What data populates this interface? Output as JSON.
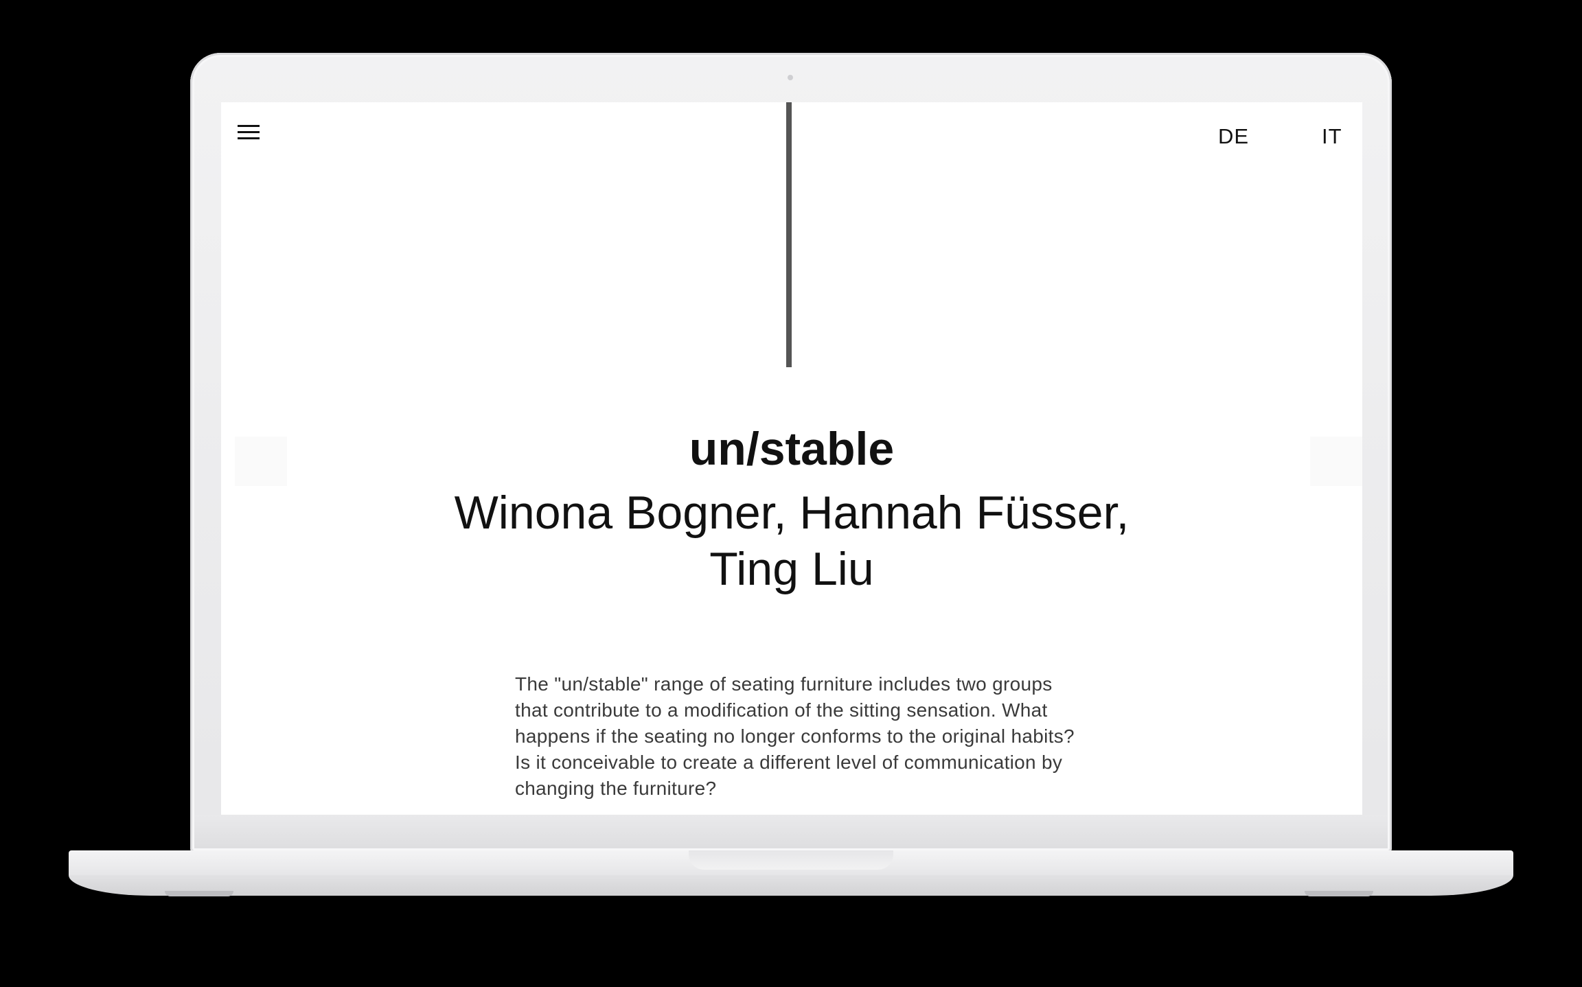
{
  "header": {
    "menu_icon": "hamburger-menu-icon",
    "languages": [
      "DE",
      "IT"
    ]
  },
  "project": {
    "title": "un/stable",
    "authors_line1": "Winona Bogner, Hannah Füsser,",
    "authors_line2": "Ting Liu",
    "description": "The \"un/stable\" range of seating furniture includes two groups that contribute to a modification of the sitting sensation. What happens if the seating no longer conforms to the original habits? Is it conceivable to create a different level of communication by changing the furniture?"
  },
  "colors": {
    "background": "#000000",
    "screen": "#ffffff",
    "text": "#111111",
    "body_text": "#3a3a3a",
    "divider": "#555555",
    "device": "#ececee"
  }
}
